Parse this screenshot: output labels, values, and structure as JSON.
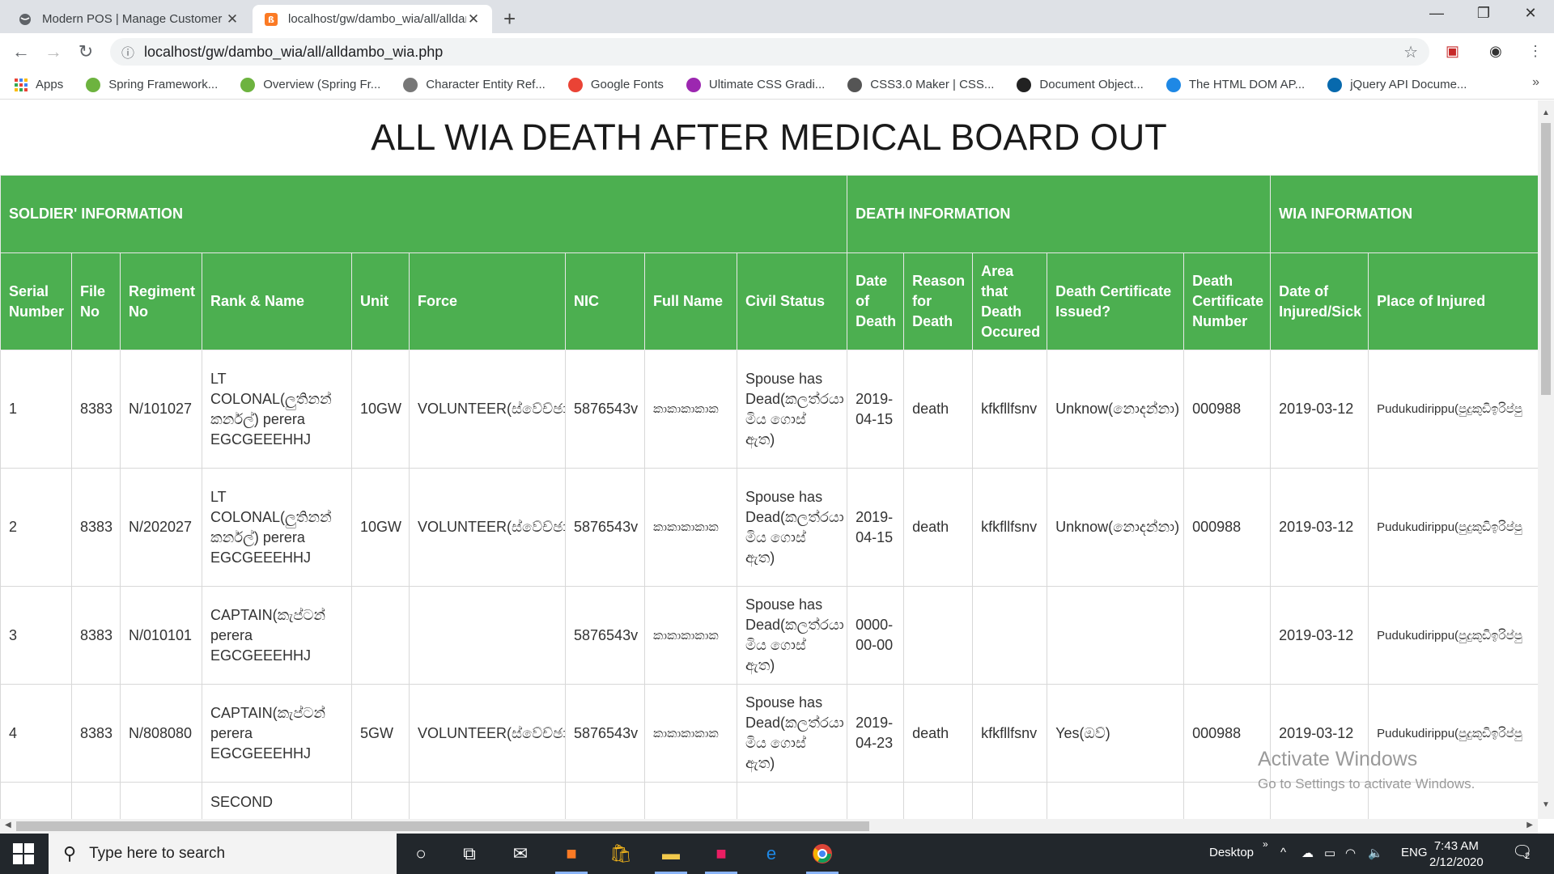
{
  "browser": {
    "tabs": [
      {
        "title": "Modern POS | Manage Customer"
      },
      {
        "title": "localhost/gw/dambo_wia/all/alldambo_wia.php"
      }
    ],
    "url": "localhost/gw/dambo_wia/all/alldambo_wia.php",
    "bookmarks": [
      {
        "label": "Apps",
        "color": "#4285f4"
      },
      {
        "label": "Spring Framework...",
        "color": "#6db33f"
      },
      {
        "label": "Overview (Spring Fr...",
        "color": "#6db33f"
      },
      {
        "label": "Character Entity Ref...",
        "color": "#777777"
      },
      {
        "label": "Google Fonts",
        "color": "#ea4335"
      },
      {
        "label": "Ultimate CSS Gradi...",
        "color": "#9c27b0"
      },
      {
        "label": "CSS3.0 Maker | CSS...",
        "color": "#555555"
      },
      {
        "label": "Document Object...",
        "color": "#222222"
      },
      {
        "label": "The HTML DOM AP...",
        "color": "#1e88e5"
      },
      {
        "label": "jQuery API Docume...",
        "color": "#0769ad"
      }
    ]
  },
  "page": {
    "title": "ALL WIA DEATH AFTER MEDICAL BOARD OUT",
    "groups": {
      "soldier": "SOLDIER' INFORMATION",
      "death": "DEATH INFORMATION",
      "wia": "WIA INFORMATION"
    },
    "columns": [
      "Serial Number",
      "File No",
      "Regiment No",
      "Rank & Name",
      "Unit",
      "Force",
      "NIC",
      "Full Name",
      "Civil Status",
      "Date of Death",
      "Reason for Death",
      "Area that Death Occured",
      "Death Certificate Issued?",
      "Death Certificate Number",
      "Date of Injured/Sick",
      "Place of Injured"
    ],
    "rows": [
      [
        "1",
        "8383",
        "N/101027",
        "LT COLONAL(ලුතිනන් කර්නල්) perera EGCGEEEHHJ",
        "10GW",
        "VOLUNTEER(ස්වේච්ඡා",
        "5876543v",
        "කාකාකාකාක",
        "Spouse has Dead(කලත්රයා මිය ගොස් ඇත)",
        "2019-04-15",
        "death",
        "kfkfllfsnv",
        "Unknow(නොදන්නා)",
        "000988",
        "2019-03-12",
        "Pudukudirippu(පුදුකුඩිඉරිප්පු"
      ],
      [
        "2",
        "8383",
        "N/202027",
        "LT COLONAL(ලුතිනන් කර්නල්) perera EGCGEEEHHJ",
        "10GW",
        "VOLUNTEER(ස්වේච්ඡා",
        "5876543v",
        "කාකාකාකාක",
        "Spouse has Dead(කලත්රයා මිය ගොස් ඇත)",
        "2019-04-15",
        "death",
        "kfkfllfsnv",
        "Unknow(නොදන්නා)",
        "000988",
        "2019-03-12",
        "Pudukudirippu(පුදුකුඩිඉරිප්පු"
      ],
      [
        "3",
        "8383",
        "N/010101",
        "CAPTAIN(කැප්ටන් perera EGCGEEEHHJ",
        "",
        "",
        "5876543v",
        "කාකාකාකාක",
        "Spouse has Dead(කලත්රයා මිය ගොස් ඇත)",
        "0000-00-00",
        "",
        "",
        "",
        "",
        "2019-03-12",
        "Pudukudirippu(පුදුකුඩිඉරිප්පු"
      ],
      [
        "4",
        "8383",
        "N/808080",
        "CAPTAIN(කැප්ටන් perera EGCGEEEHHJ",
        "5GW",
        "VOLUNTEER(ස්වේච්ඡා",
        "5876543v",
        "කාකාකාකාක",
        "Spouse has Dead(කලත්රයා මිය ගොස් ඇත)",
        "2019-04-23",
        "death",
        "kfkfllfsnv",
        "Yes(ඔව්)",
        "000988",
        "2019-03-12",
        "Pudukudirippu(පුදුකුඩිඉරිප්පු"
      ],
      [
        "",
        "",
        "",
        "SECOND",
        "",
        "",
        "",
        "",
        "",
        "",
        "",
        "",
        "",
        "",
        "",
        ""
      ]
    ]
  },
  "watermark": {
    "line1": "Activate Windows",
    "line2": "Go to Settings to activate Windows."
  },
  "taskbar": {
    "search_placeholder": "Type here to search",
    "desktop_label": "Desktop",
    "language": "ENG",
    "time": "7:43 AM",
    "date": "2/12/2020",
    "notifications": "2"
  }
}
